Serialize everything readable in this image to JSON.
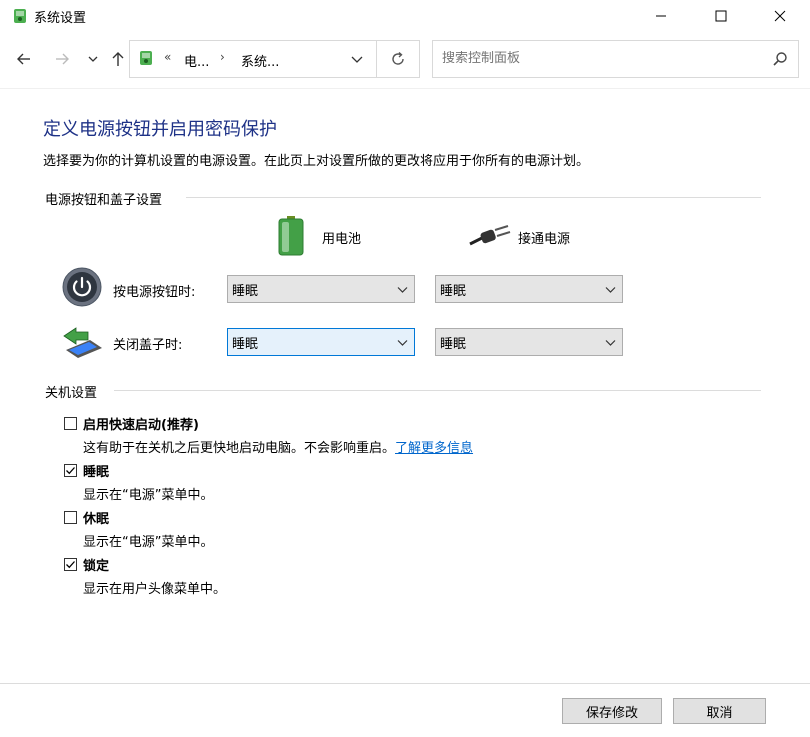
{
  "window": {
    "title": "系统设置"
  },
  "address_bar": {
    "overflow_glyph": "«",
    "crumbs": [
      "电...",
      "系统..."
    ],
    "separator": "›"
  },
  "search": {
    "placeholder": "搜索控制面板"
  },
  "page": {
    "title": "定义电源按钮并启用密码保护",
    "description": "选择要为你的计算机设置的电源设置。在此页上对设置所做的更改将应用于你所有的电源计划。"
  },
  "power_group": {
    "label": "电源按钮和盖子设置",
    "columns": {
      "battery": "用电池",
      "ac": "接通电源"
    },
    "rows": [
      {
        "label": "按电源按钮时:",
        "battery_value": "睡眠",
        "ac_value": "睡眠"
      },
      {
        "label": "关闭盖子时:",
        "battery_value": "睡眠",
        "ac_value": "睡眠"
      }
    ]
  },
  "shutdown_group": {
    "label": "关机设置",
    "options": [
      {
        "title": "启用快速启动(推荐)",
        "checked": false,
        "desc": "这有助于在关机之后更快地启动电脑。不会影响重启。",
        "link": "了解更多信息"
      },
      {
        "title": "睡眠",
        "checked": true,
        "desc": "显示在“电源”菜单中。"
      },
      {
        "title": "休眠",
        "checked": false,
        "desc": "显示在“电源”菜单中。"
      },
      {
        "title": "锁定",
        "checked": true,
        "desc": "显示在用户头像菜单中。"
      }
    ]
  },
  "buttons": {
    "save": "保存修改",
    "cancel": "取消"
  },
  "colors": {
    "title_blue": "#1e3287",
    "link_blue": "#0066cc",
    "focus_border": "#0078d7"
  }
}
